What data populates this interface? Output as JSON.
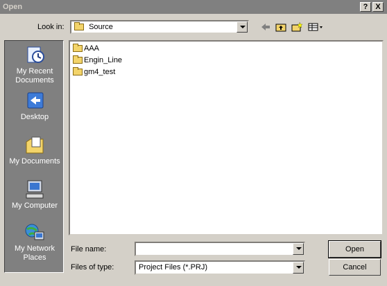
{
  "window": {
    "title": "Open",
    "help_btn": "?",
    "close_btn": "X"
  },
  "lookin": {
    "label": "Look in:",
    "value": "Source"
  },
  "toolbar": {
    "icons": [
      "back-arrow-icon",
      "up-folder-icon",
      "new-folder-icon",
      "view-menu-icon"
    ]
  },
  "places": [
    {
      "label": "My Recent Documents",
      "icon": "recent-documents-icon"
    },
    {
      "label": "Desktop",
      "icon": "desktop-icon"
    },
    {
      "label": "My Documents",
      "icon": "my-documents-icon"
    },
    {
      "label": "My Computer",
      "icon": "my-computer-icon"
    },
    {
      "label": "My Network Places",
      "icon": "network-places-icon"
    }
  ],
  "files": [
    "AAA",
    "Engin_Line",
    "gm4_test"
  ],
  "filename": {
    "label": "File name:",
    "value": ""
  },
  "filetype": {
    "label": "Files of type:",
    "value": "Project Files (*.PRJ)"
  },
  "buttons": {
    "open": "Open",
    "cancel": "Cancel"
  }
}
